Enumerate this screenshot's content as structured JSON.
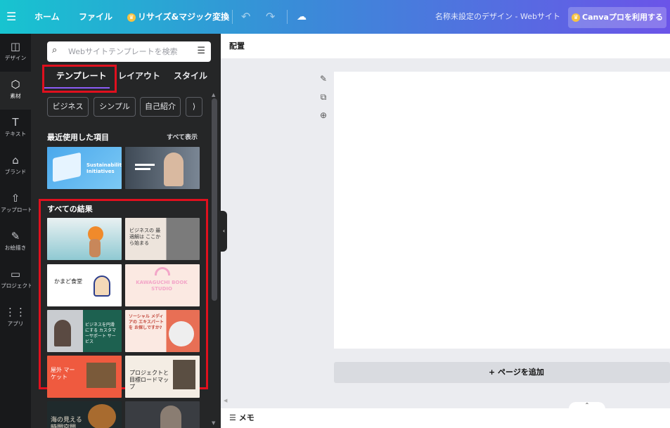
{
  "topbar": {
    "menu_icon": "☰",
    "home": "ホーム",
    "file": "ファイル",
    "resize_magic": "リサイズ&マジック変換",
    "undo_icon": "↶",
    "redo_icon": "↷",
    "cloud_icon": "☁",
    "doc_title": "名称未設定のデザイン - Webサイト",
    "pro_button": "Canvaプロを利用する",
    "crown_icon": "♛"
  },
  "rail": [
    {
      "icon": "◫",
      "label": "デザイン"
    },
    {
      "icon": "⬡",
      "label": "素材"
    },
    {
      "icon": "T",
      "label": "テキスト"
    },
    {
      "icon": "⌂",
      "label": "ブランド"
    },
    {
      "icon": "⇧",
      "label": "アップロード"
    },
    {
      "icon": "✎",
      "label": "お絵描き"
    },
    {
      "icon": "▭",
      "label": "プロジェクト"
    },
    {
      "icon": "⋮⋮",
      "label": "アプリ"
    }
  ],
  "panel": {
    "search_placeholder": "Webサイトテンプレートを検索",
    "tabs": [
      "テンプレート",
      "レイアウト",
      "スタイル"
    ],
    "chips": [
      "ビジネス",
      "シンプル",
      "自己紹介",
      "⟩"
    ],
    "recent_title": "最近使用した項目",
    "show_all": "すべて表示",
    "all_results_title": "すべての結果",
    "recent_thumbs": [
      {
        "text": "Sustainability Initiatives"
      },
      {
        "text": ""
      }
    ],
    "result_thumbs": [
      {
        "text": ""
      },
      {
        "text": "ビジネスの 最適解は ここから始まる"
      },
      {
        "text": "かまど食堂"
      },
      {
        "text": "KAWAGUCHI BOOK STUDIO"
      },
      {
        "text": "ビジネスを円滑にする カスタマーサポート サービス"
      },
      {
        "text": "ソーシャル メディアの エキスパートを お探しですか?"
      },
      {
        "text": "屋外 マーケット"
      },
      {
        "text": "プロジェクトと 目標ロードマップ"
      },
      {
        "text": "海の見える 時間空間"
      },
      {
        "text": ""
      }
    ]
  },
  "canvas": {
    "context_label": "配置",
    "tools": [
      "✎",
      "⧉",
      "⊕"
    ],
    "add_page": "+ ページを追加",
    "memo": "メモ",
    "memo_icon": "☰"
  },
  "colors": {
    "topbar_start": "#17c4d0",
    "topbar_end": "#6b54e8",
    "panel_bg": "#252627",
    "rail_bg": "#18191b",
    "highlight_red": "#e0101e",
    "tab_accent": "#8b5cf6"
  }
}
